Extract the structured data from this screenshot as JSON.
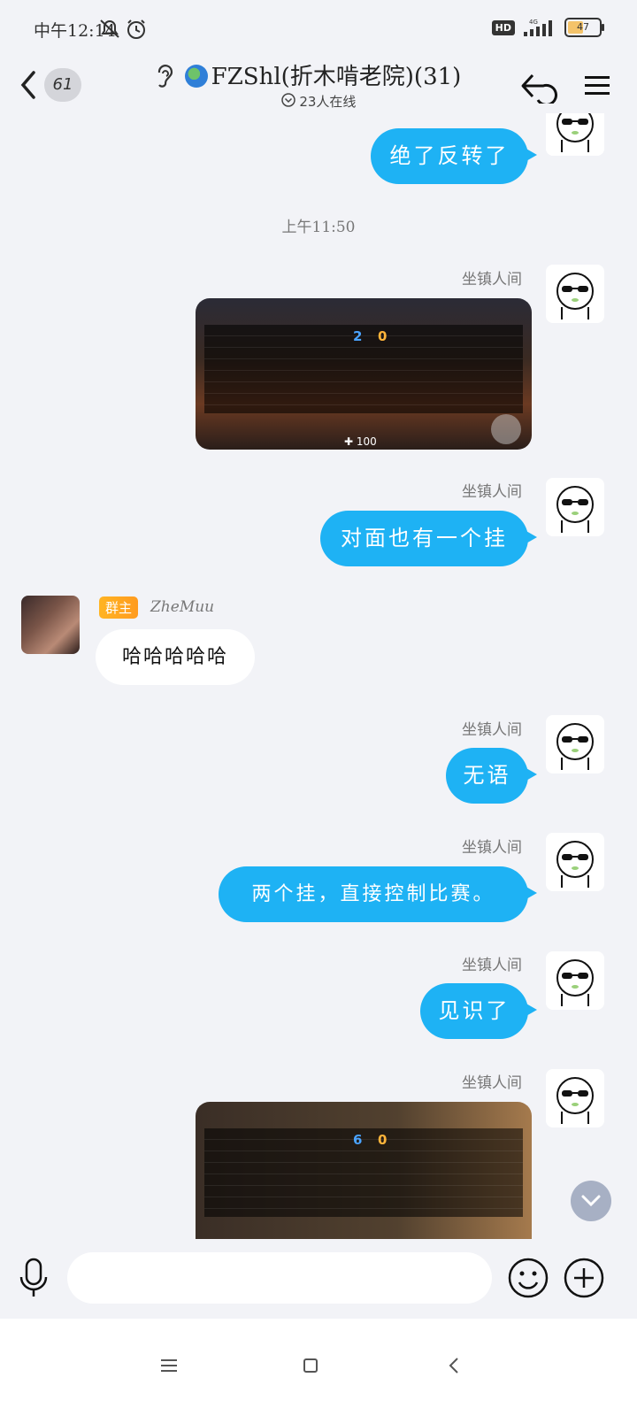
{
  "status": {
    "time": "中午12:14",
    "battery": "47",
    "hd": "HD",
    "network": "4G"
  },
  "header": {
    "unread_count": "61",
    "title": "FZShl(折木啃老院)(31)",
    "online": "23人在线"
  },
  "messages": {
    "m1": {
      "text": "绝了反转了"
    },
    "time_divider": "上午11:50",
    "m2": {
      "sender": "坐镇人间"
    },
    "m3": {
      "sender": "坐镇人间",
      "text": "对面也有一个挂"
    },
    "m4": {
      "badge": "群主",
      "sender": "ZheMuu",
      "text": "哈哈哈哈哈"
    },
    "m5": {
      "sender": "坐镇人间",
      "text": "无语"
    },
    "m6": {
      "sender": "坐镇人间",
      "text": "两个挂，直接控制比赛。"
    },
    "m7": {
      "sender": "坐镇人间",
      "text": "见识了"
    },
    "m8": {
      "sender": "坐镇人间"
    }
  },
  "screenshot1": {
    "score_ct": "2",
    "score_t": "0",
    "hp": "100"
  },
  "screenshot2": {
    "score_ct": "6",
    "score_t": "0"
  },
  "input": {
    "placeholder": ""
  },
  "colors": {
    "bubble": "#1eb2f4",
    "background": "#f2f3f7",
    "owner_badge": "#ffb422"
  }
}
